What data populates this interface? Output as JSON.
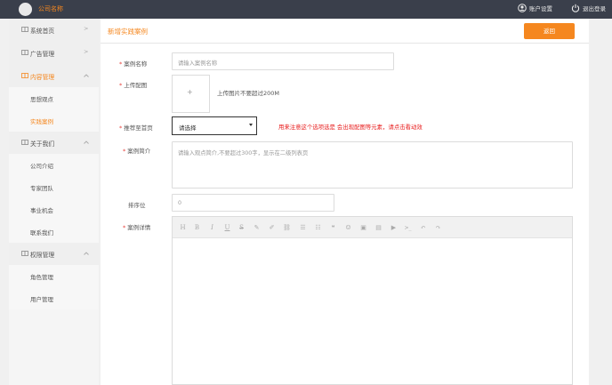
{
  "header": {
    "company_name": "公司名称",
    "account_settings": "账户设置",
    "logout": "退出登录",
    "account_icon": "user-circle-icon",
    "logout_icon": "power-icon"
  },
  "sidebar": {
    "items": [
      {
        "label": "系统首页",
        "icon": "grid-icon",
        "arrow": ">",
        "expanded": false
      },
      {
        "label": "广告管理",
        "icon": "grid-icon",
        "arrow": ">",
        "expanded": false
      },
      {
        "label": "内容管理",
        "icon": "grid-icon",
        "arrow": "^",
        "expanded": true,
        "children": [
          {
            "label": "思想观点",
            "active": false
          },
          {
            "label": "实践案例",
            "active": true
          }
        ]
      },
      {
        "label": "关于我们",
        "icon": "grid-icon",
        "arrow": "^",
        "expanded": true,
        "children": [
          {
            "label": "公司介绍"
          },
          {
            "label": "专家团队"
          },
          {
            "label": "事业机会"
          },
          {
            "label": "联系我们"
          }
        ]
      },
      {
        "label": "权限管理",
        "icon": "grid-icon",
        "arrow": "^",
        "expanded": true,
        "children": [
          {
            "label": "角色管理"
          },
          {
            "label": "用户管理"
          }
        ]
      }
    ]
  },
  "page": {
    "title": "新增实践案例",
    "back_label": "返回"
  },
  "form": {
    "case_name": {
      "label": "案例名称",
      "required": true,
      "placeholder": "请输入案例名称",
      "value": ""
    },
    "image": {
      "label": "上传配图",
      "required": true,
      "plus": "+",
      "hint": "上传图片不要超过200M"
    },
    "recommend": {
      "label": "推荐至首页",
      "required": true,
      "value": "请选择",
      "note": "用来注意这个选项选是 会出现配图等元素，请点击看动效"
    },
    "summary": {
      "label": "案例简介",
      "required": true,
      "placeholder": "请输入观点简介,不要超过300字，显示在二级列表页",
      "value": ""
    },
    "sort": {
      "label": "排序位",
      "required": false,
      "value": "0"
    },
    "detail": {
      "label": "案例详情",
      "required": true
    }
  },
  "editor_toolbar": [
    {
      "name": "heading-icon",
      "glyph": "H"
    },
    {
      "name": "bold-icon",
      "glyph": "B"
    },
    {
      "name": "italic-icon",
      "glyph": "I"
    },
    {
      "name": "underline-icon",
      "glyph": "U"
    },
    {
      "name": "strikethrough-icon",
      "glyph": "S"
    },
    {
      "name": "brush-icon",
      "glyph": "✎"
    },
    {
      "name": "pen-icon",
      "glyph": "✐"
    },
    {
      "name": "link-icon",
      "glyph": "⛓"
    },
    {
      "name": "list-icon",
      "glyph": "☰"
    },
    {
      "name": "ordered-list-icon",
      "glyph": "☷"
    },
    {
      "name": "quote-icon",
      "glyph": "❝"
    },
    {
      "name": "emoji-icon",
      "glyph": "☺"
    },
    {
      "name": "image-icon",
      "glyph": "▣"
    },
    {
      "name": "table-icon",
      "glyph": "▤"
    },
    {
      "name": "video-icon",
      "glyph": "▶"
    },
    {
      "name": "code-icon",
      "glyph": ">_"
    },
    {
      "name": "undo-icon",
      "glyph": "↶"
    },
    {
      "name": "redo-icon",
      "glyph": "↷"
    }
  ],
  "colors": {
    "accent": "#f5871f",
    "topbar": "#3a3f4b",
    "required": "#e8423c",
    "note": "#e81e1e"
  }
}
